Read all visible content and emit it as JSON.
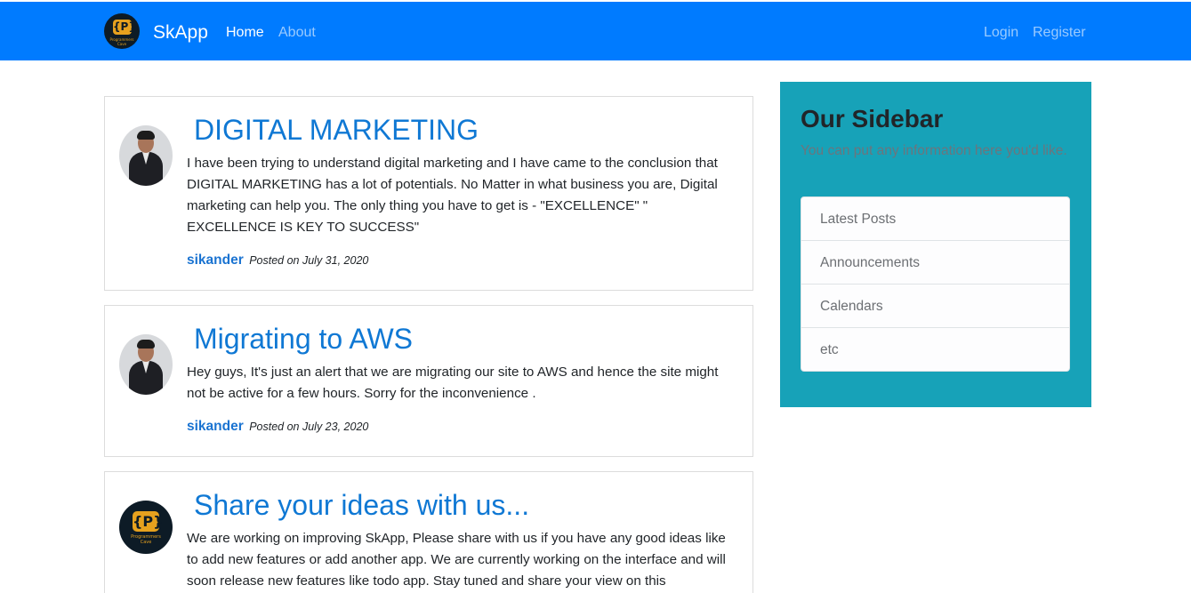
{
  "navbar": {
    "brand": "SkApp",
    "logo_text": "Programmers Cave",
    "logo_glyph": "{P}",
    "links": {
      "home": "Home",
      "about": "About",
      "login": "Login",
      "register": "Register"
    }
  },
  "posts": [
    {
      "title": "DIGITAL MARKETING",
      "body": "I have been trying to understand digital marketing and I have came to the conclusion that DIGITAL MARKETING has a lot of potentials. No Matter in what business you are, Digital marketing can help you. The only thing you have to get is - \"EXCELLENCE\" \" EXCELLENCE IS KEY TO SUCCESS\"",
      "author": "sikander",
      "posted": "Posted on July 31, 2020"
    },
    {
      "title": "Migrating to AWS",
      "body": "Hey guys, It's just an alert that we are migrating our site to AWS and hence the site might not be active for a few hours. Sorry for the inconvenience .",
      "author": "sikander",
      "posted": "Posted on July 23, 2020"
    },
    {
      "title": "Share your ideas with us...",
      "body": "We are working on improving SkApp, Please share with us if you have any good ideas like to add new features or add another app. We are currently working on the interface and will soon release new features like todo app. Stay tuned and share your view on this"
    }
  ],
  "sidebar": {
    "title": "Our Sidebar",
    "text": "You can put any information here you'd like.",
    "items": [
      "Latest Posts",
      "Announcements",
      "Calendars",
      "etc"
    ]
  },
  "colors": {
    "navbar": "#007bff",
    "sidebar": "#17a2b8",
    "link": "#0f78d4"
  }
}
